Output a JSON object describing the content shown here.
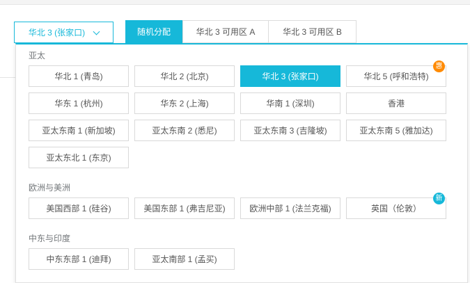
{
  "accent_color": "#16b8d9",
  "region_select": {
    "selected_label": "华北 3 (张家口)",
    "chevron_icon": "chevron-down"
  },
  "zone_tabs": [
    {
      "label": "随机分配",
      "selected": true
    },
    {
      "label": "华北 3 可用区 A",
      "selected": false
    },
    {
      "label": "华北 3 可用区 B",
      "selected": false
    }
  ],
  "region_panel": {
    "groups": [
      {
        "label": "亚太",
        "regions": [
          {
            "label": "华北 1 (青岛)"
          },
          {
            "label": "华北 2 (北京)"
          },
          {
            "label": "华北 3 (张家口)",
            "selected": true
          },
          {
            "label": "华北 5 (呼和浩特)",
            "badge": "惠",
            "badge_color": "#ff8a00"
          },
          {
            "label": "华东 1 (杭州)"
          },
          {
            "label": "华东 2 (上海)"
          },
          {
            "label": "华南 1 (深圳)"
          },
          {
            "label": "香港"
          },
          {
            "label": "亚太东南 1 (新加坡)"
          },
          {
            "label": "亚太东南 2 (悉尼)"
          },
          {
            "label": "亚太东南 3 (吉隆坡)"
          },
          {
            "label": "亚太东南 5 (雅加达)"
          },
          {
            "label": "亚太东北 1 (东京)"
          }
        ]
      },
      {
        "label": "欧洲与美洲",
        "regions": [
          {
            "label": "美国西部 1 (硅谷)"
          },
          {
            "label": "美国东部 1 (弗吉尼亚)"
          },
          {
            "label": "欧洲中部 1 (法兰克福)"
          },
          {
            "label": "英国（伦敦）",
            "badge": "新",
            "badge_color": "#16b8d9"
          }
        ]
      },
      {
        "label": "中东与印度",
        "regions": [
          {
            "label": "中东东部 1 (迪拜)"
          },
          {
            "label": "亚太南部 1 (孟买)"
          }
        ]
      }
    ]
  }
}
